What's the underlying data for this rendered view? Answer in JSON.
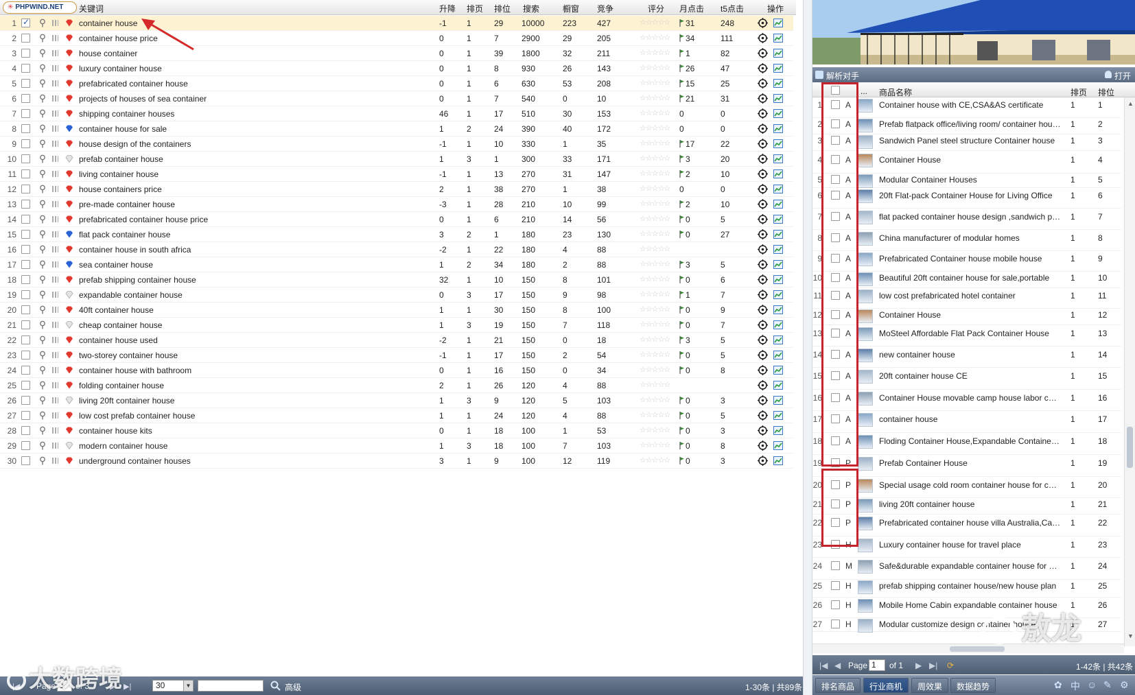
{
  "left": {
    "logo_text": "PHPWIND.NET",
    "columns": {
      "keyword": "关键词",
      "change": "升降",
      "page": "排页",
      "position": "排位",
      "search": "搜索",
      "showcase": "橱窗",
      "competition": "竞争",
      "rating": "评分",
      "monthly_clicks": "月点击",
      "t5_clicks": "t5点击",
      "action": "操作"
    },
    "rows": [
      {
        "n": "1",
        "kw": "container house",
        "chg": "-1",
        "pg": "1",
        "pos": "29",
        "srch": "10000",
        "win": "223",
        "comp": "427",
        "mc": "31",
        "t5": "248",
        "gem": "red",
        "checked": true
      },
      {
        "n": "2",
        "kw": "container house price",
        "chg": "0",
        "pg": "1",
        "pos": "7",
        "srch": "2900",
        "win": "29",
        "comp": "205",
        "mc": "34",
        "t5": "111",
        "gem": "red"
      },
      {
        "n": "3",
        "kw": "house container",
        "chg": "0",
        "pg": "1",
        "pos": "39",
        "srch": "1800",
        "win": "32",
        "comp": "211",
        "mc": "1",
        "t5": "82",
        "gem": "red"
      },
      {
        "n": "4",
        "kw": "luxury container house",
        "chg": "0",
        "pg": "1",
        "pos": "8",
        "srch": "930",
        "win": "26",
        "comp": "143",
        "mc": "26",
        "t5": "47",
        "gem": "red"
      },
      {
        "n": "5",
        "kw": "prefabricated container house",
        "chg": "0",
        "pg": "1",
        "pos": "6",
        "srch": "630",
        "win": "53",
        "comp": "208",
        "mc": "15",
        "t5": "25",
        "gem": "red"
      },
      {
        "n": "6",
        "kw": "projects of houses of sea container",
        "chg": "0",
        "pg": "1",
        "pos": "7",
        "srch": "540",
        "win": "0",
        "comp": "10",
        "mc": "21",
        "t5": "31",
        "gem": "red"
      },
      {
        "n": "7",
        "kw": "shipping container houses",
        "chg": "46",
        "pg": "1",
        "pos": "17",
        "srch": "510",
        "win": "30",
        "comp": "153",
        "mc": "0",
        "t5": "0",
        "gem": "red",
        "noflag": true
      },
      {
        "n": "8",
        "kw": "container house for sale",
        "chg": "1",
        "pg": "2",
        "pos": "24",
        "srch": "390",
        "win": "40",
        "comp": "172",
        "mc": "0",
        "t5": "0",
        "gem": "blue",
        "noflag": true
      },
      {
        "n": "9",
        "kw": "house design of the containers",
        "chg": "-1",
        "pg": "1",
        "pos": "10",
        "srch": "330",
        "win": "1",
        "comp": "35",
        "mc": "17",
        "t5": "22",
        "gem": "red"
      },
      {
        "n": "10",
        "kw": "prefab container house",
        "chg": "1",
        "pg": "3",
        "pos": "1",
        "srch": "300",
        "win": "33",
        "comp": "171",
        "mc": "3",
        "t5": "20",
        "gem": "white"
      },
      {
        "n": "11",
        "kw": "living container house",
        "chg": "-1",
        "pg": "1",
        "pos": "13",
        "srch": "270",
        "win": "31",
        "comp": "147",
        "mc": "2",
        "t5": "10",
        "gem": "red"
      },
      {
        "n": "12",
        "kw": "house containers price",
        "chg": "2",
        "pg": "1",
        "pos": "38",
        "srch": "270",
        "win": "1",
        "comp": "38",
        "mc": "0",
        "t5": "0",
        "gem": "red",
        "noflag": true
      },
      {
        "n": "13",
        "kw": "pre-made container house",
        "chg": "-3",
        "pg": "1",
        "pos": "28",
        "srch": "210",
        "win": "10",
        "comp": "99",
        "mc": "2",
        "t5": "10",
        "gem": "red"
      },
      {
        "n": "14",
        "kw": "prefabricated container house price",
        "chg": "0",
        "pg": "1",
        "pos": "6",
        "srch": "210",
        "win": "14",
        "comp": "56",
        "mc": "0",
        "t5": "5",
        "gem": "red"
      },
      {
        "n": "15",
        "kw": "flat pack container house",
        "chg": "3",
        "pg": "2",
        "pos": "1",
        "srch": "180",
        "win": "23",
        "comp": "130",
        "mc": "0",
        "t5": "27",
        "gem": "blue"
      },
      {
        "n": "16",
        "kw": "container house in south africa",
        "chg": "-2",
        "pg": "1",
        "pos": "22",
        "srch": "180",
        "win": "4",
        "comp": "88",
        "mc": "",
        "t5": "",
        "gem": "red",
        "noflag": true
      },
      {
        "n": "17",
        "kw": "sea container house",
        "chg": "1",
        "pg": "2",
        "pos": "34",
        "srch": "180",
        "win": "2",
        "comp": "88",
        "mc": "3",
        "t5": "5",
        "gem": "blue"
      },
      {
        "n": "18",
        "kw": "prefab shipping container house",
        "chg": "32",
        "pg": "1",
        "pos": "10",
        "srch": "150",
        "win": "8",
        "comp": "101",
        "mc": "0",
        "t5": "6",
        "gem": "red"
      },
      {
        "n": "19",
        "kw": "expandable container house",
        "chg": "0",
        "pg": "3",
        "pos": "17",
        "srch": "150",
        "win": "9",
        "comp": "98",
        "mc": "1",
        "t5": "7",
        "gem": "white"
      },
      {
        "n": "20",
        "kw": "40ft container house",
        "chg": "1",
        "pg": "1",
        "pos": "30",
        "srch": "150",
        "win": "8",
        "comp": "100",
        "mc": "0",
        "t5": "9",
        "gem": "red"
      },
      {
        "n": "21",
        "kw": "cheap container house",
        "chg": "1",
        "pg": "3",
        "pos": "19",
        "srch": "150",
        "win": "7",
        "comp": "118",
        "mc": "0",
        "t5": "7",
        "gem": "white"
      },
      {
        "n": "22",
        "kw": "container house used",
        "chg": "-2",
        "pg": "1",
        "pos": "21",
        "srch": "150",
        "win": "0",
        "comp": "18",
        "mc": "3",
        "t5": "5",
        "gem": "red"
      },
      {
        "n": "23",
        "kw": "two-storey container house",
        "chg": "-1",
        "pg": "1",
        "pos": "17",
        "srch": "150",
        "win": "2",
        "comp": "54",
        "mc": "0",
        "t5": "5",
        "gem": "red"
      },
      {
        "n": "24",
        "kw": "container house with bathroom",
        "chg": "0",
        "pg": "1",
        "pos": "16",
        "srch": "150",
        "win": "0",
        "comp": "34",
        "mc": "0",
        "t5": "8",
        "gem": "red"
      },
      {
        "n": "25",
        "kw": "folding container house",
        "chg": "2",
        "pg": "1",
        "pos": "26",
        "srch": "120",
        "win": "4",
        "comp": "88",
        "mc": "",
        "t5": "",
        "gem": "red",
        "noflag": true
      },
      {
        "n": "26",
        "kw": "living 20ft container house",
        "chg": "1",
        "pg": "3",
        "pos": "9",
        "srch": "120",
        "win": "5",
        "comp": "103",
        "mc": "0",
        "t5": "3",
        "gem": "white"
      },
      {
        "n": "27",
        "kw": "low cost prefab container house",
        "chg": "1",
        "pg": "1",
        "pos": "24",
        "srch": "120",
        "win": "4",
        "comp": "88",
        "mc": "0",
        "t5": "5",
        "gem": "red"
      },
      {
        "n": "28",
        "kw": "container house kits",
        "chg": "0",
        "pg": "1",
        "pos": "18",
        "srch": "100",
        "win": "1",
        "comp": "53",
        "mc": "0",
        "t5": "3",
        "gem": "red"
      },
      {
        "n": "29",
        "kw": "modern container house",
        "chg": "1",
        "pg": "3",
        "pos": "18",
        "srch": "100",
        "win": "7",
        "comp": "103",
        "mc": "0",
        "t5": "8",
        "gem": "white"
      },
      {
        "n": "30",
        "kw": "underground container houses",
        "chg": "3",
        "pg": "1",
        "pos": "9",
        "srch": "100",
        "win": "12",
        "comp": "119",
        "mc": "0",
        "t5": "3",
        "gem": "red"
      }
    ],
    "footer": {
      "page_label": "Page",
      "page_value": "1",
      "of_label": "of 3",
      "page_size": "30",
      "advanced": "高级",
      "summary": "1-30条 | 共89条"
    }
  },
  "watermarks": {
    "left": "大数跨境",
    "right": "敖龙"
  },
  "right": {
    "title": "解析对手",
    "open_label": "打开",
    "columns": {
      "dots": "...",
      "name": "商品名称",
      "page": "排页",
      "position": "排位"
    },
    "rows": [
      {
        "n": "1",
        "t": "A",
        "name": "Container house with CE,CSA&AS certificate",
        "pg": "1",
        "ps": "1",
        "h": 30
      },
      {
        "n": "2",
        "t": "A",
        "name": "Prefab flatpack office/living room/ container house",
        "pg": "1",
        "ps": "2",
        "h": 24
      },
      {
        "n": "3",
        "t": "A",
        "name": "Sandwich Panel steel structure Container house",
        "pg": "1",
        "ps": "3",
        "h": 24
      },
      {
        "n": "4",
        "t": "A",
        "name": "Container House",
        "pg": "1",
        "ps": "4",
        "h": 33
      },
      {
        "n": "5",
        "t": "A",
        "name": "Modular Container Houses",
        "pg": "1",
        "ps": "5",
        "h": 21
      },
      {
        "n": "6",
        "t": "A",
        "name": "20ft Flat-pack Container House for Living Office",
        "pg": "1",
        "ps": "6",
        "h": 30
      },
      {
        "n": "7",
        "t": "A",
        "name": "flat packed container house design ,sandwich panel",
        "pg": "1",
        "ps": "7",
        "h": 31
      },
      {
        "n": "8",
        "t": "A",
        "name": "China manufacturer of modular homes",
        "pg": "1",
        "ps": "8",
        "h": 31
      },
      {
        "n": "9",
        "t": "A",
        "name": "Prefabricated Container house mobile house",
        "pg": "1",
        "ps": "9",
        "h": 30
      },
      {
        "n": "10",
        "t": "A",
        "name": "Beautiful 20ft container house for sale,portable",
        "pg": "1",
        "ps": "10",
        "h": 24
      },
      {
        "n": "11",
        "t": "A",
        "name": "low cost prefabricated hotel container",
        "pg": "1",
        "ps": "11",
        "h": 30
      },
      {
        "n": "12",
        "t": "A",
        "name": "Container House",
        "pg": "1",
        "ps": "12",
        "h": 24
      },
      {
        "n": "13",
        "t": "A",
        "name": "MoSteel Affordable Flat Pack Container House",
        "pg": "1",
        "ps": "13",
        "h": 31
      },
      {
        "n": "14",
        "t": "A",
        "name": "new container house",
        "pg": "1",
        "ps": "14",
        "h": 31
      },
      {
        "n": "15",
        "t": "A",
        "name": "20ft container house CE",
        "pg": "1",
        "ps": "15",
        "h": 32
      },
      {
        "n": "16",
        "t": "A",
        "name": "Container House movable camp house labor camp",
        "pg": "1",
        "ps": "16",
        "h": 31
      },
      {
        "n": "17",
        "t": "A",
        "name": "container house",
        "pg": "1",
        "ps": "17",
        "h": 32
      },
      {
        "n": "18",
        "t": "A",
        "name": "Floding Container House,Expandable Container House",
        "pg": "1",
        "ps": "18",
        "h": 32
      },
      {
        "n": "19",
        "t": "P",
        "name": "Prefab Container House",
        "pg": "1",
        "ps": "19",
        "h": 32
      },
      {
        "n": "20",
        "t": "P",
        "name": "Special usage cold room container house for cold storage",
        "pg": "1",
        "ps": "20",
        "h": 31
      },
      {
        "n": "21",
        "t": "P",
        "name": "living 20ft container house",
        "pg": "1",
        "ps": "21",
        "h": 24
      },
      {
        "n": "22",
        "t": "P",
        "name": "Prefabricated container house villa Australia,Canada",
        "pg": "1",
        "ps": "22",
        "h": 32
      },
      {
        "n": "23",
        "t": "H",
        "name": "Luxury container house for travel place",
        "pg": "1",
        "ps": "23",
        "h": 31
      },
      {
        "n": "24",
        "t": "M",
        "name": "Safe&durable expandable container house for sale",
        "pg": "1",
        "ps": "24",
        "h": 32
      },
      {
        "n": "25",
        "t": "H",
        "name": "prefab shipping container house/new house plan",
        "pg": "1",
        "ps": "25",
        "h": 26
      },
      {
        "n": "26",
        "t": "H",
        "name": "Mobile Home Cabin expandable container house",
        "pg": "1",
        "ps": "26",
        "h": 30
      },
      {
        "n": "27",
        "t": "H",
        "name": "Modular customize design container house",
        "pg": "1",
        "ps": "27",
        "h": 20
      }
    ],
    "pager": {
      "page_label": "Page",
      "page_value": "1",
      "of_label": "of 1",
      "summary": "1-42条 | 共42条"
    },
    "tabs": [
      "排名商品",
      "行业商机",
      "周效果",
      "数据趋势"
    ],
    "tray": [
      "中"
    ]
  },
  "colors": {
    "highlight_row": "#fdf3d3",
    "red_annotation": "#c8232c",
    "bar_dark": "#4d5d72"
  }
}
